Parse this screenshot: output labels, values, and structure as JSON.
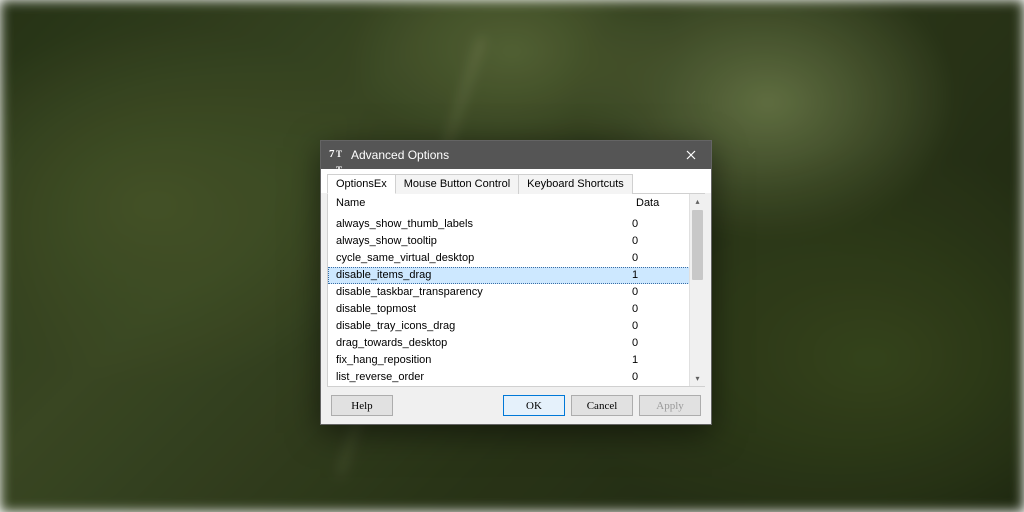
{
  "dialog": {
    "title": "Advanced Options",
    "tabs": [
      {
        "label": "OptionsEx",
        "active": true
      },
      {
        "label": "Mouse Button Control",
        "active": false
      },
      {
        "label": "Keyboard Shortcuts",
        "active": false
      }
    ],
    "columns": {
      "name": "Name",
      "data": "Data"
    },
    "rows": [
      {
        "name": "always_show_thumb_labels",
        "data": "0",
        "selected": false
      },
      {
        "name": "always_show_tooltip",
        "data": "0",
        "selected": false
      },
      {
        "name": "cycle_same_virtual_desktop",
        "data": "0",
        "selected": false
      },
      {
        "name": "disable_items_drag",
        "data": "1",
        "selected": true
      },
      {
        "name": "disable_taskbar_transparency",
        "data": "0",
        "selected": false
      },
      {
        "name": "disable_topmost",
        "data": "0",
        "selected": false
      },
      {
        "name": "disable_tray_icons_drag",
        "data": "0",
        "selected": false
      },
      {
        "name": "drag_towards_desktop",
        "data": "0",
        "selected": false
      },
      {
        "name": "fix_hang_reposition",
        "data": "1",
        "selected": false
      },
      {
        "name": "list_reverse_order",
        "data": "0",
        "selected": false
      }
    ],
    "buttons": {
      "help": "Help",
      "ok": "OK",
      "cancel": "Cancel",
      "apply": "Apply"
    }
  }
}
